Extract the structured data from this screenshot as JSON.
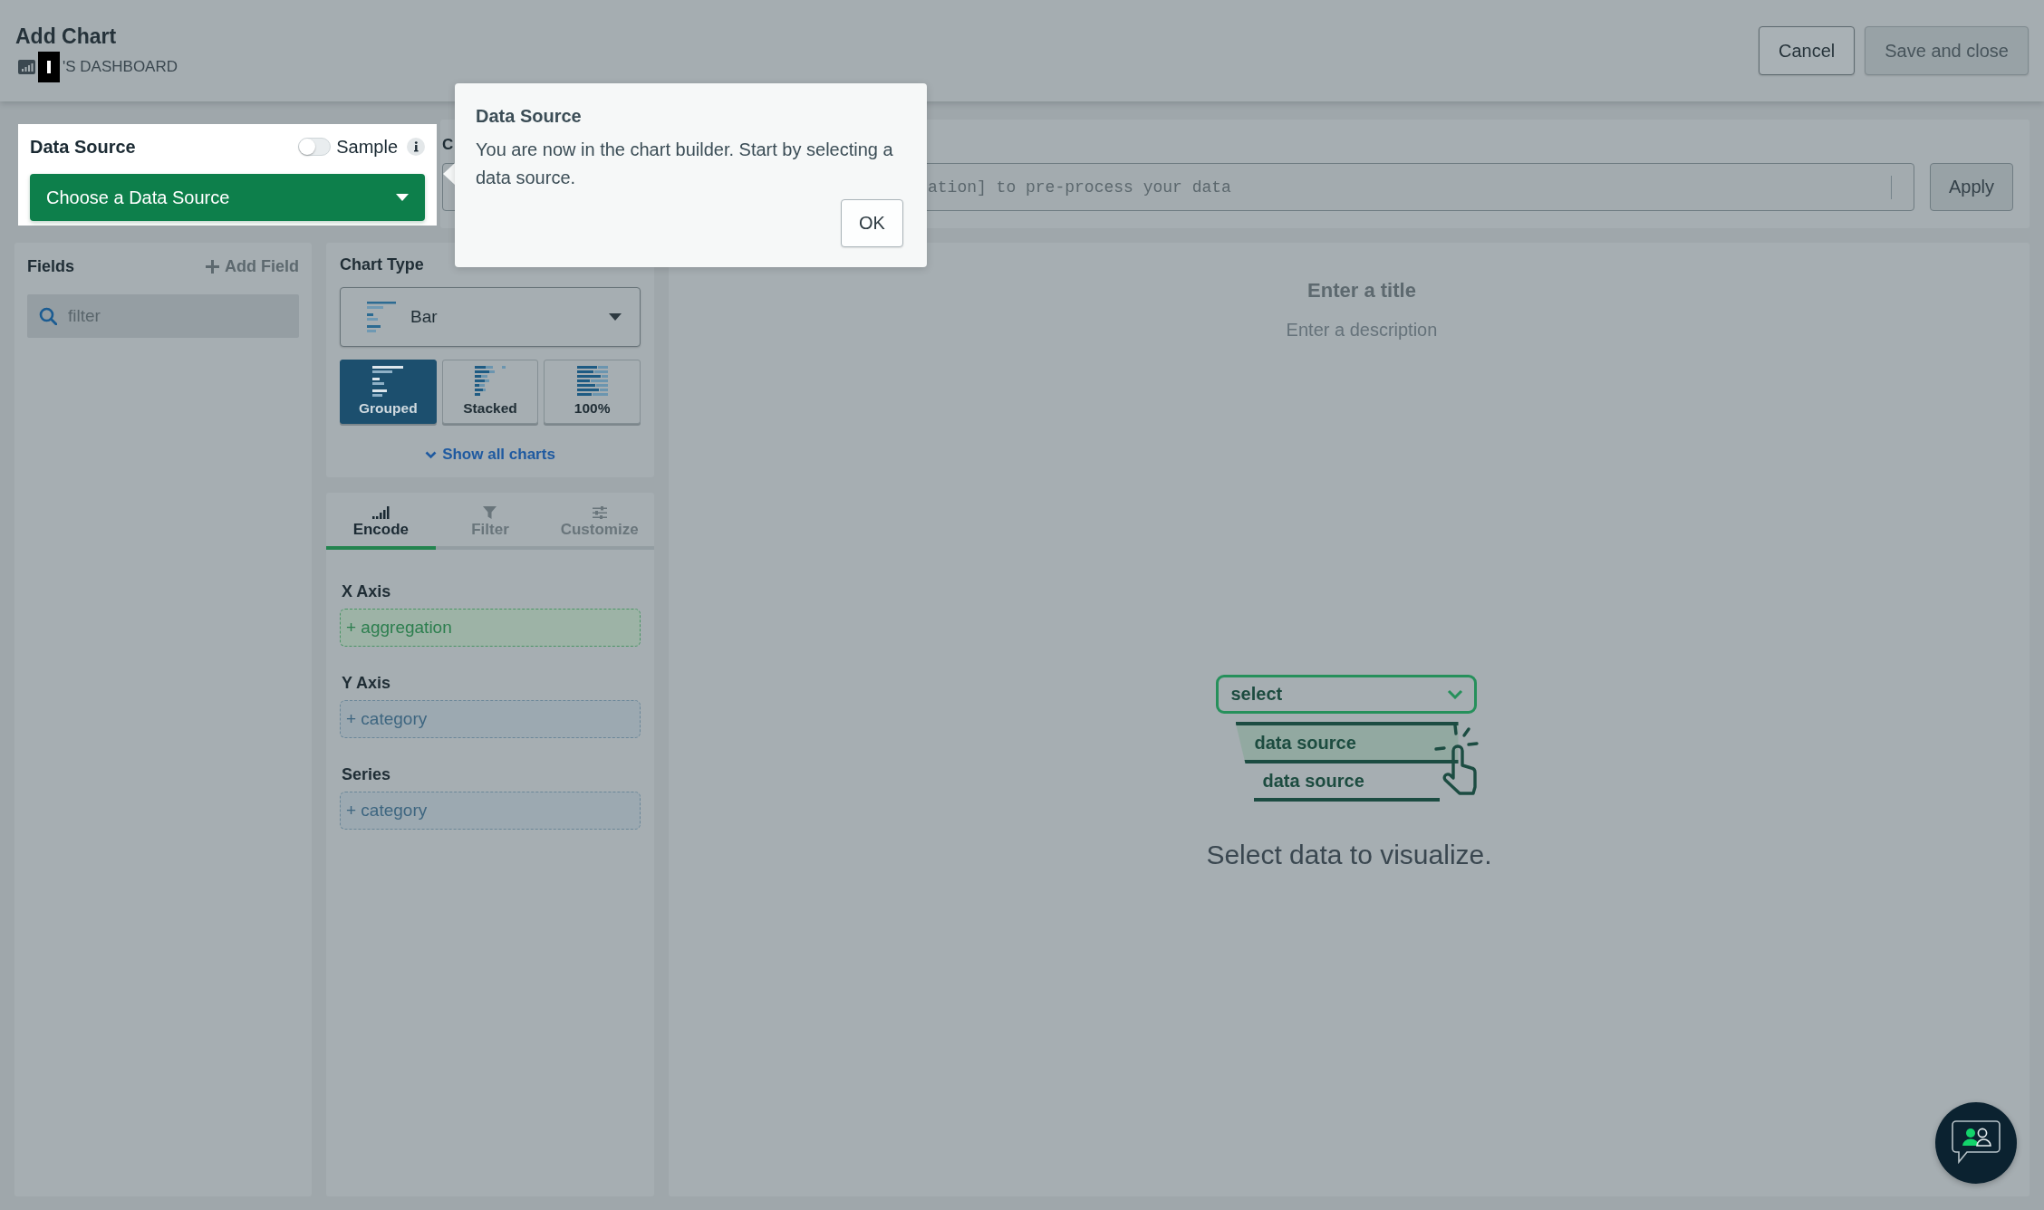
{
  "header": {
    "title": "Add Chart",
    "dashboard": "'S DASHBOARD",
    "buttons": [
      {
        "label": "Cancel",
        "disabled": false
      },
      {
        "label": "Save and close",
        "disabled": true
      }
    ]
  },
  "data_source": {
    "title": "Data Source",
    "sample_label": "Sample",
    "sample_on": false,
    "button": "Choose a Data Source"
  },
  "query": {
    "label": "C",
    "placeholder": "ation] to pre-process your data",
    "button": "Apply"
  },
  "tour_popover": {
    "title": "Data Source",
    "text": "You are now in the chart builder. Start by selecting a data source.",
    "button": "OK"
  },
  "fields": {
    "title": "Fields",
    "add_button": "Add Field",
    "filter_placeholder": "filter"
  },
  "chart_type": {
    "title": "Chart Type",
    "value": "Bar",
    "variants": [
      {
        "label": "Grouped",
        "kind": "grouped",
        "selected": true
      },
      {
        "label": "Stacked",
        "kind": "stacked",
        "selected": false
      },
      {
        "label": "100%",
        "kind": "percent",
        "selected": false
      }
    ],
    "show_all": "Show all charts"
  },
  "encoding": {
    "tabs": [
      {
        "label": "Encode",
        "kind": "encode",
        "selected": true
      },
      {
        "label": "Filter",
        "kind": "filter",
        "selected": false
      },
      {
        "label": "Customize",
        "kind": "customize",
        "selected": false
      }
    ],
    "channels": [
      {
        "label": "X Axis",
        "kind": "aggregation",
        "drop_hint": "+ aggregation"
      },
      {
        "label": "Y Axis",
        "kind": "category",
        "drop_hint": "+ category"
      },
      {
        "label": "Series",
        "kind": "category",
        "drop_hint": "+ category"
      }
    ]
  },
  "canvas": {
    "title_placeholder": "Enter a title",
    "description_placeholder": "Enter a description",
    "illustration": {
      "select": "select",
      "options": [
        "data source",
        "data source"
      ]
    },
    "message": "Select data to visualize."
  }
}
